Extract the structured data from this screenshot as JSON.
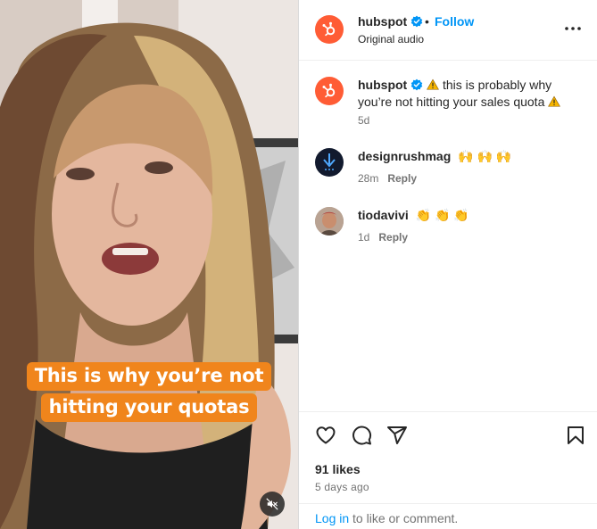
{
  "video": {
    "caption_line1": "This is why you’re not",
    "caption_line2": "hitting your quotas",
    "mute_icon": "speaker-muted-icon",
    "caption_color": "#f0851c"
  },
  "header": {
    "username": "hubspot",
    "separator": "•",
    "follow_label": "Follow",
    "audio_label": "Original audio",
    "more_icon": "more-horizontal-icon",
    "avatar_color": "#ff5c35"
  },
  "comments": [
    {
      "username": "hubspot",
      "text_before": "this is probably why you’re not hitting your sales quota",
      "time": "5d",
      "reply_label": ""
    },
    {
      "username": "designrushmag",
      "text": "🙌 🙌 🙌",
      "time": "28m",
      "reply_label": "Reply"
    },
    {
      "username": "tiodavivi",
      "text": "👏 👏 👏",
      "time": "1d",
      "reply_label": "Reply"
    }
  ],
  "actions": {
    "like_icon": "heart-icon",
    "comment_icon": "comment-bubble-icon",
    "share_icon": "paper-plane-icon",
    "save_icon": "bookmark-icon",
    "likes_text": "91 likes",
    "date_text": "5 days ago"
  },
  "footer": {
    "login_label": "Log in",
    "rest_text": " to like or comment."
  },
  "colors": {
    "link_blue": "#0095f6",
    "brand_orange": "#ff5c35",
    "muted_text": "#737373"
  }
}
